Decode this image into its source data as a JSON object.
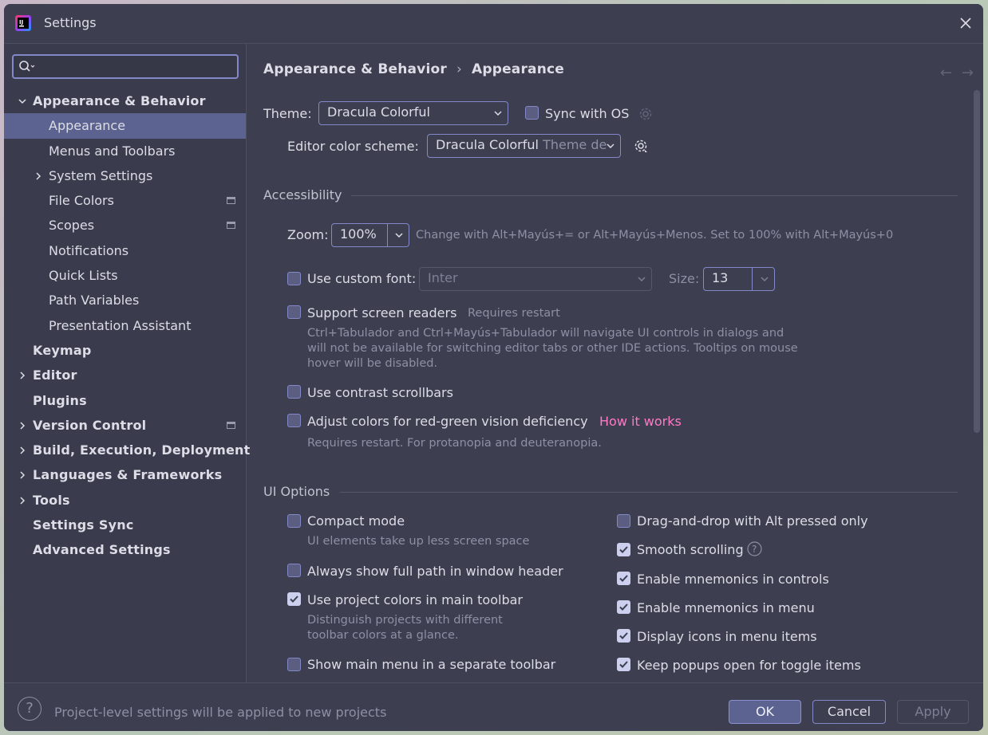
{
  "window": {
    "title": "Settings"
  },
  "sidebar": {
    "search_placeholder": "",
    "items": [
      {
        "label": "Appearance & Behavior",
        "expanded": true
      },
      {
        "label": "Appearance",
        "selected": true
      },
      {
        "label": "Menus and Toolbars"
      },
      {
        "label": "System Settings"
      },
      {
        "label": "File Colors"
      },
      {
        "label": "Scopes"
      },
      {
        "label": "Notifications"
      },
      {
        "label": "Quick Lists"
      },
      {
        "label": "Path Variables"
      },
      {
        "label": "Presentation Assistant"
      },
      {
        "label": "Keymap"
      },
      {
        "label": "Editor"
      },
      {
        "label": "Plugins"
      },
      {
        "label": "Version Control"
      },
      {
        "label": "Build, Execution, Deployment"
      },
      {
        "label": "Languages & Frameworks"
      },
      {
        "label": "Tools"
      },
      {
        "label": "Settings Sync"
      },
      {
        "label": "Advanced Settings"
      }
    ]
  },
  "breadcrumb": {
    "parent": "Appearance & Behavior",
    "current": "Appearance",
    "separator": "›"
  },
  "nav": {
    "back": "←",
    "forward": "→"
  },
  "theme": {
    "label": "Theme:",
    "value": "Dracula Colorful",
    "sync_label": "Sync with OS"
  },
  "scheme": {
    "label": "Editor color scheme:",
    "value": "Dracula Colorful",
    "value_suffix": "Theme de"
  },
  "accessibility": {
    "title": "Accessibility",
    "zoom_label": "Zoom:",
    "zoom_value": "100%",
    "zoom_hint": "Change with Alt+Mayús+= or Alt+Mayús+Menos. Set to 100% with Alt+Mayús+0",
    "custom_font_label": "Use custom font:",
    "custom_font_value": "Inter",
    "size_label": "Size:",
    "size_value": "13",
    "screen_readers_label": "Support screen readers",
    "screen_readers_note": "Requires restart",
    "screen_readers_desc_1": "Ctrl+Tabulador and Ctrl+Mayús+Tabulador will navigate UI controls in dialogs and",
    "screen_readers_desc_2": "will not be available for switching editor tabs or other IDE actions. Tooltips on mouse",
    "screen_readers_desc_3": "hover will be disabled.",
    "contrast_label": "Use contrast scrollbars",
    "color_adjust_label": "Adjust colors for red-green vision deficiency",
    "color_adjust_link": "How it works",
    "color_adjust_desc": "Requires restart. For protanopia and deuteranopia."
  },
  "ui_options": {
    "title": "UI Options",
    "left": [
      {
        "label": "Compact mode",
        "checked": false,
        "desc": "UI elements take up less screen space"
      },
      {
        "label": "Always show full path in window header",
        "checked": false
      },
      {
        "label": "Use project colors in main toolbar",
        "checked": true,
        "desc_1": "Distinguish projects with different",
        "desc_2": "toolbar colors at a glance."
      },
      {
        "label": "Show main menu in a separate toolbar",
        "checked": false
      }
    ],
    "right": [
      {
        "label": "Drag-and-drop with Alt pressed only",
        "checked": false
      },
      {
        "label": "Smooth scrolling",
        "checked": true
      },
      {
        "label": "Enable mnemonics in controls",
        "checked": true
      },
      {
        "label": "Enable mnemonics in menu",
        "checked": true
      },
      {
        "label": "Display icons in menu items",
        "checked": true
      },
      {
        "label": "Keep popups open for toggle items",
        "checked": true
      }
    ]
  },
  "footer": {
    "help": "?",
    "message": "Project-level settings will be applied to new projects",
    "ok": "OK",
    "cancel": "Cancel",
    "apply": "Apply"
  },
  "colors": {
    "background": "#3d3f50",
    "selection": "#5c6390",
    "accent": "#8288c8",
    "link": "#ff79c6"
  }
}
